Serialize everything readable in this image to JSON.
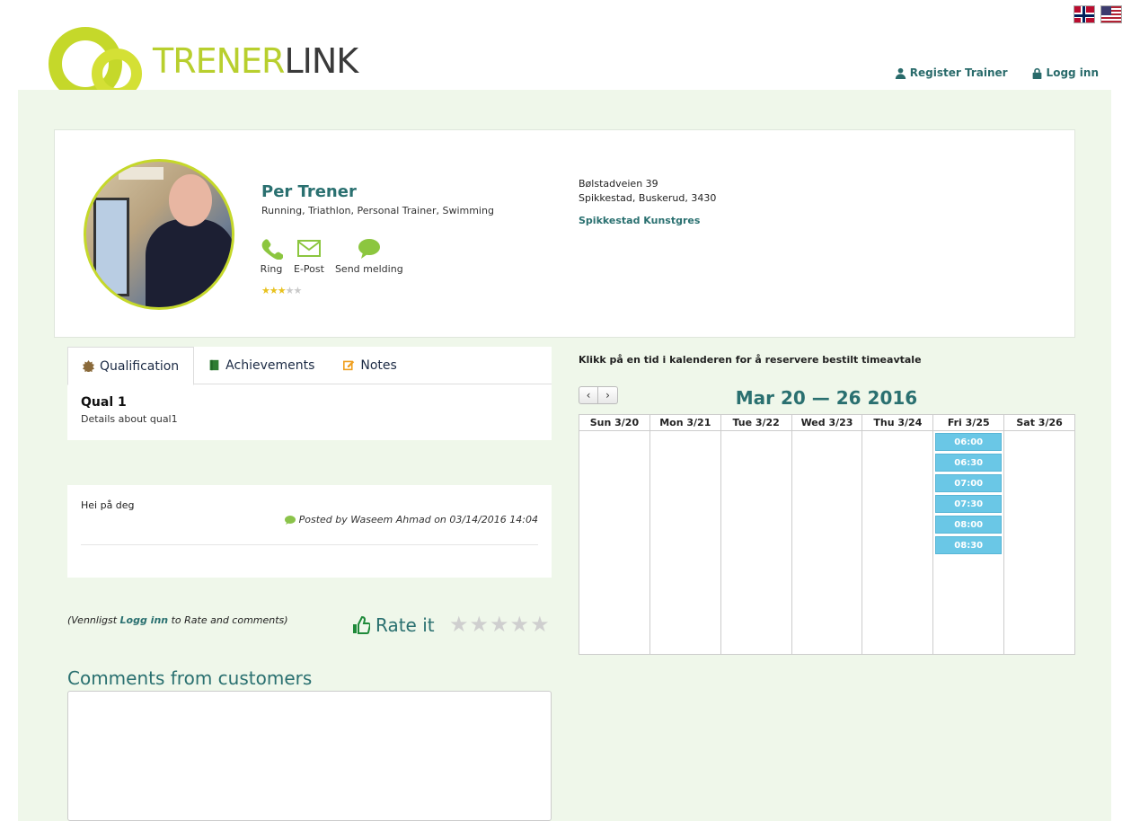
{
  "header": {
    "logo_part1": "TRENER",
    "logo_part2": "LINK",
    "register_label": "Register Trainer",
    "login_label": "Logg inn",
    "flags": [
      "norwegian-flag",
      "us-flag"
    ]
  },
  "profile": {
    "name": "Per Trener",
    "tags": "Running, Triathlon, Personal Trainer, Swimming",
    "contacts": [
      {
        "label": "Ring",
        "icon": "phone-icon"
      },
      {
        "label": "E-Post",
        "icon": "mail-icon"
      },
      {
        "label": "Send melding",
        "icon": "chat-icon"
      }
    ],
    "rating": 3,
    "rating_max": 5,
    "address_line1": "Bølstadveien 39",
    "address_line2": "Spikkestad, Buskerud, 3430",
    "venue": "Spikkestad Kunstgres"
  },
  "tabs": [
    {
      "label": "Qualification",
      "icon": "badge-icon",
      "active": true
    },
    {
      "label": "Achievements",
      "icon": "book-icon",
      "active": false
    },
    {
      "label": "Notes",
      "icon": "edit-icon",
      "active": false
    }
  ],
  "qualification": {
    "title": "Qual 1",
    "details": "Details about qual1"
  },
  "note": {
    "text": "Hei på deg",
    "meta": "Posted by Waseem Ahmad on 03/14/2016 14:04"
  },
  "rating_section": {
    "hint_prefix": "(Vennligst ",
    "hint_link": "Logg inn",
    "hint_suffix": "  to Rate and comments)",
    "rate_label": "Rate it"
  },
  "comments": {
    "title": "Comments from customers",
    "value": ""
  },
  "calendar": {
    "hint": "Klikk på en tid i kalenderen for å reservere bestilt timeavtale",
    "prev_label": "‹",
    "next_label": "›",
    "title": "Mar 20 — 26 2016",
    "days": [
      "Sun 3/20",
      "Mon 3/21",
      "Tue 3/22",
      "Wed 3/23",
      "Thu 3/24",
      "Fri 3/25",
      "Sat 3/26"
    ],
    "slots_day": "Fri 3/25",
    "slots": [
      "06:00",
      "06:30",
      "07:00",
      "07:30",
      "08:00",
      "08:30"
    ]
  },
  "colors": {
    "accent": "#2a7070",
    "brand_green": "#c5d82a",
    "slot_blue": "#6ac7e6",
    "page_bg": "#eff7ea"
  }
}
